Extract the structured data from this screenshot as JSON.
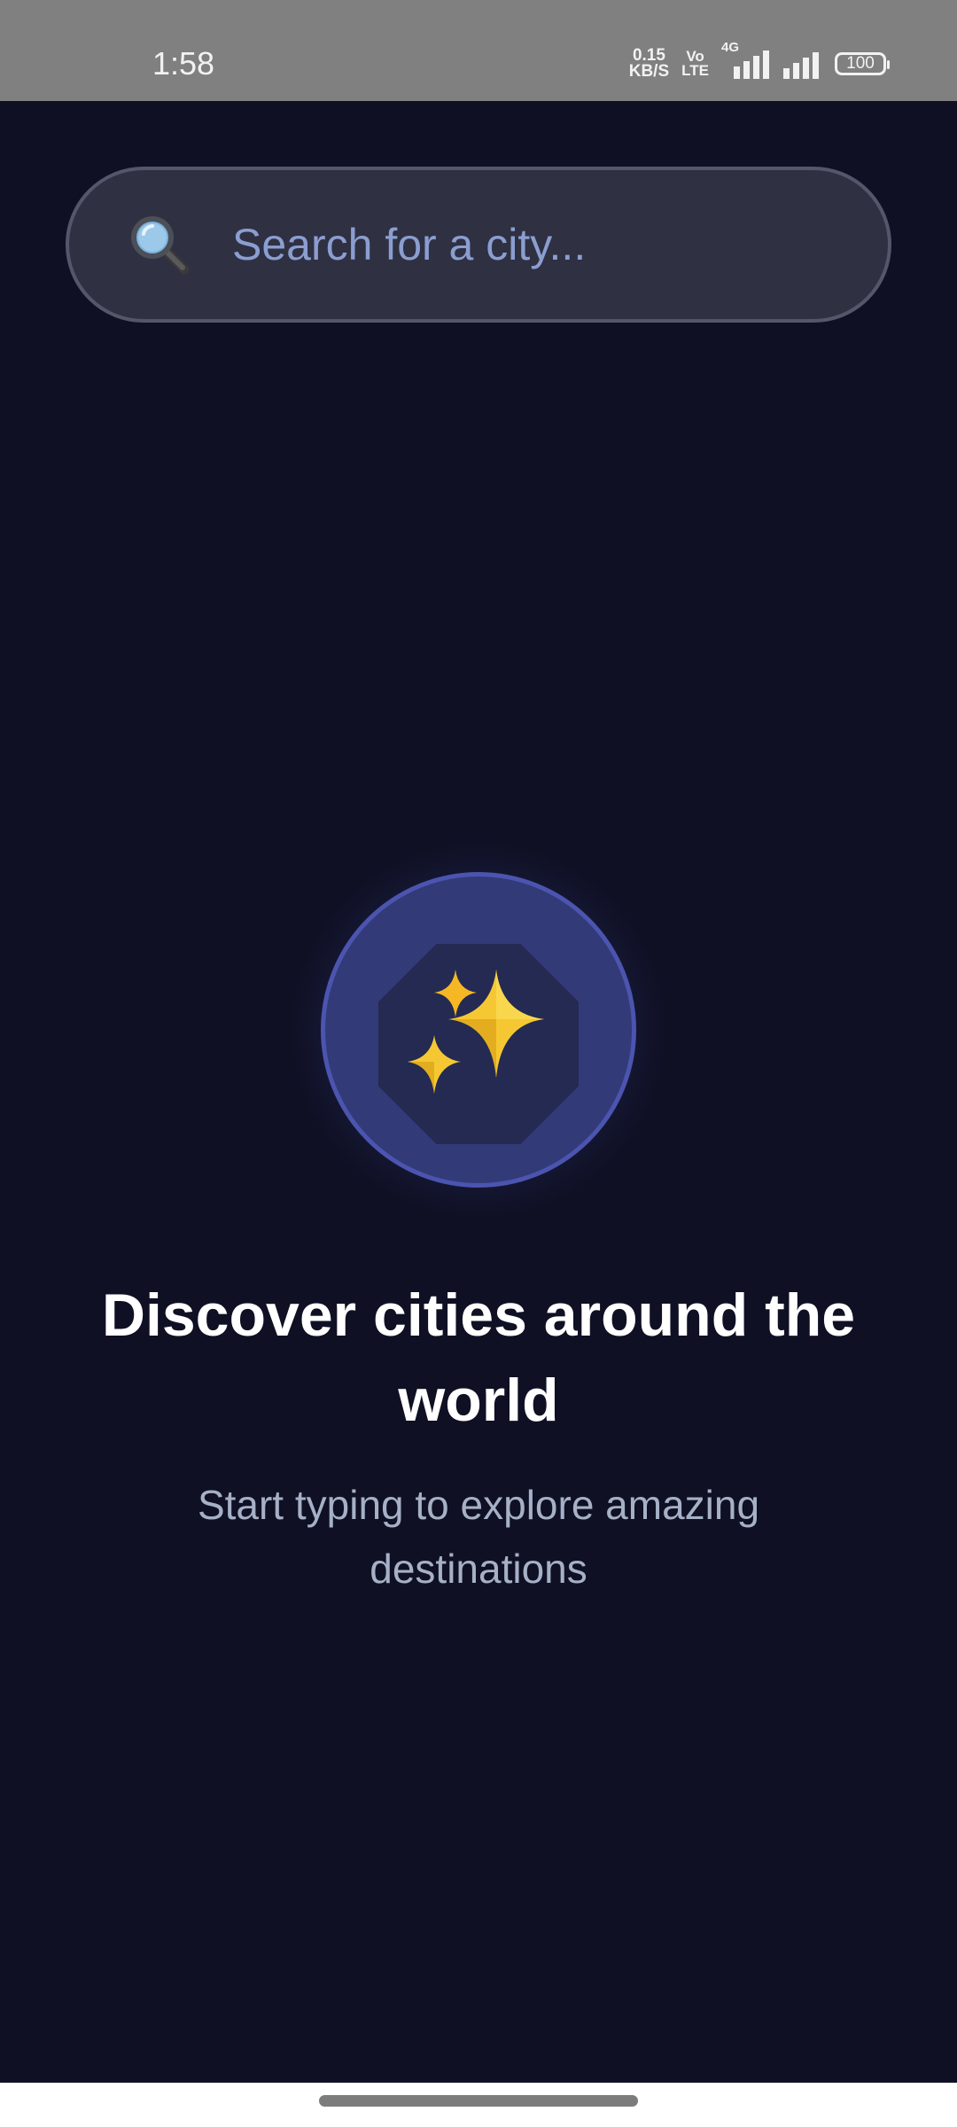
{
  "status_bar": {
    "time": "1:58",
    "net_speed_value": "0.15",
    "net_speed_unit": "KB/S",
    "volte_top": "Vo",
    "volte_bottom": "LTE",
    "network_type": "4G",
    "battery": "100"
  },
  "search": {
    "placeholder": "Search for a city...",
    "value": "",
    "icon": "magnifying-glass-icon"
  },
  "hero": {
    "icon": "sparkles-icon",
    "title": "Discover cities around the world",
    "subtitle": "Start typing to explore amazing destinations"
  },
  "colors": {
    "background": "#0f1024",
    "status_bar": "#808080",
    "search_bg": "#2f3042",
    "search_border": "#55566a",
    "placeholder": "#8b9ed0",
    "hero_circle": "#333a78",
    "hero_ring": "#4b55b0",
    "sparkle": "#f5c833",
    "subtitle": "#a6b0c6"
  }
}
